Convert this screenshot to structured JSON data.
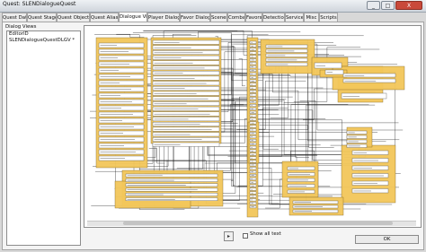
{
  "window": {
    "title": "Quest: SLENDialogueQuest"
  },
  "window_buttons": {
    "minimize": "_",
    "maximize": "□",
    "close": "X"
  },
  "tabs": [
    {
      "label": "Quest Data"
    },
    {
      "label": "Quest Stages"
    },
    {
      "label": "Quest Objectives"
    },
    {
      "label": "Quest Aliases"
    },
    {
      "label": "Dialogue Views"
    },
    {
      "label": "Player Dialogue"
    },
    {
      "label": "Favor Dialogue"
    },
    {
      "label": "Scenes"
    },
    {
      "label": "Combat"
    },
    {
      "label": "Favors"
    },
    {
      "label": "Detection"
    },
    {
      "label": "Service"
    },
    {
      "label": "Misc"
    },
    {
      "label": "Scripts"
    }
  ],
  "active_tab": "Dialogue Views",
  "dialog_views": {
    "label": "Dialog Views",
    "header": "EditorID",
    "items": [
      "SLENDialogueQuestDLGV *"
    ]
  },
  "controls": {
    "show_all_text": "Show all text",
    "ok": "OK"
  },
  "colors": {
    "node_fill": "#f3c75a",
    "node_stroke": "#7a6020",
    "link": "#1a1a1a"
  }
}
